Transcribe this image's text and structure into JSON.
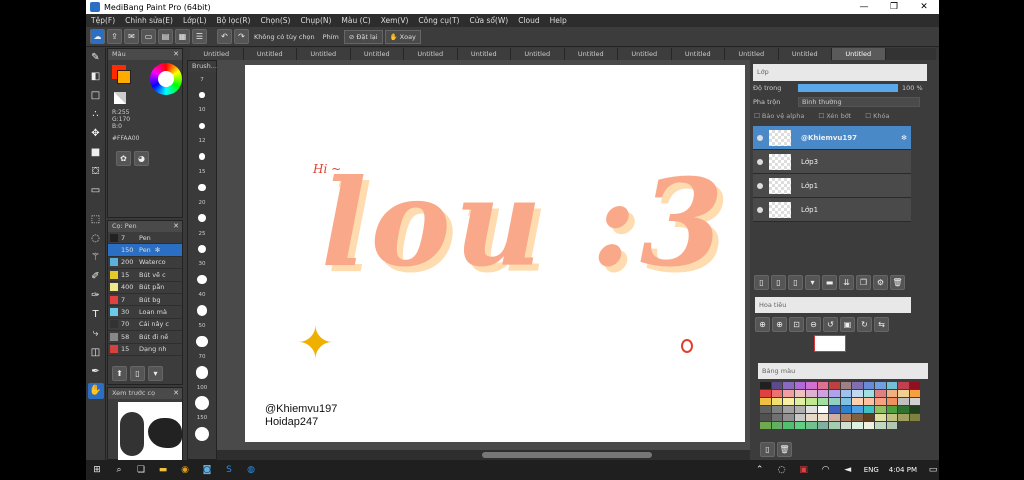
{
  "window": {
    "title": "MediBang Paint Pro (64bit)"
  },
  "menu": [
    "Tệp(F)",
    "Chỉnh sửa(E)",
    "Lớp(L)",
    "Bộ lọc(R)",
    "Chọn(S)",
    "Chụp(N)",
    "Màu (C)",
    "Xem(V)",
    "Công cụ(T)",
    "Cửa sổ(W)",
    "Cloud",
    "Help"
  ],
  "toolbar": {
    "antialias_label": "Không có tùy chọn",
    "hotkey_label": "Phím",
    "reset_label": "Đặt lại",
    "rotate_label": "Xoay"
  },
  "tabs": [
    "Untitled",
    "Untitled",
    "Untitled",
    "Untitled",
    "Untitled",
    "Untitled",
    "Untitled",
    "Untitled",
    "Untitled",
    "Untitled",
    "Untitled",
    "Untitled",
    "Untitled"
  ],
  "color_panel": {
    "title": "Màu",
    "r": "R:255",
    "g": "G:170",
    "b": "B:0",
    "hex": "#FFAA00"
  },
  "brush_panel": {
    "title": "Cọ: Pen",
    "items": [
      {
        "size": "7",
        "name": "Pen",
        "color": "#222222"
      },
      {
        "size": "150",
        "name": "Pen",
        "color": "#2b6fc4",
        "selected": true
      },
      {
        "size": "200",
        "name": "Waterco",
        "color": "#5ab0d8"
      },
      {
        "size": "15",
        "name": "Bút vẽ c",
        "color": "#e6c82a"
      },
      {
        "size": "400",
        "name": "Bút pẫn",
        "color": "#f0e68c"
      },
      {
        "size": "7",
        "name": "Bút bg",
        "color": "#e04040"
      },
      {
        "size": "30",
        "name": "Loan mà",
        "color": "#6cc8e8"
      },
      {
        "size": "70",
        "name": "Cái nây c",
        "color": "#333333"
      },
      {
        "size": "58",
        "name": "Bút đi nề",
        "color": "#888888"
      },
      {
        "size": "15",
        "name": "Dạng nh",
        "color": "#d84040"
      }
    ]
  },
  "preview_panel": {
    "title": "Xem trước cọ"
  },
  "size_panel": {
    "title": "Brush...",
    "sizes": [
      "7",
      "10",
      "12",
      "15",
      "20",
      "25",
      "30",
      "40",
      "50",
      "70",
      "100",
      "150"
    ]
  },
  "canvas": {
    "deco_text": "Hi ~",
    "main_text": "lou :3",
    "credit_line1": "@Khiemvu197",
    "credit_line2": "Hoidap247"
  },
  "layer_panel": {
    "title": "Lớp",
    "opacity_label": "Độ trong",
    "opacity_value": "100 %",
    "blend_label": "Pha trộn",
    "blend_value": "Bình thường",
    "protect_alpha": "Bảo vệ alpha",
    "clip": "Xén bớt",
    "lock": "Khóa",
    "layers": [
      {
        "name": "@Khiemvu197",
        "selected": true
      },
      {
        "name": "Lớp3"
      },
      {
        "name": "Lớp1"
      },
      {
        "name": "Lớp1"
      }
    ]
  },
  "navigator_panel": {
    "title": "Hoa tiêu"
  },
  "palette_panel": {
    "title": "Bảng màu"
  },
  "taskbar": {
    "lang": "ENG",
    "time": "4:04 PM"
  },
  "colors": {
    "accent": "#2b6fc4",
    "peach": "#f9a98a",
    "shadow": "#ffdcb0",
    "orange": "#ffaa00"
  }
}
